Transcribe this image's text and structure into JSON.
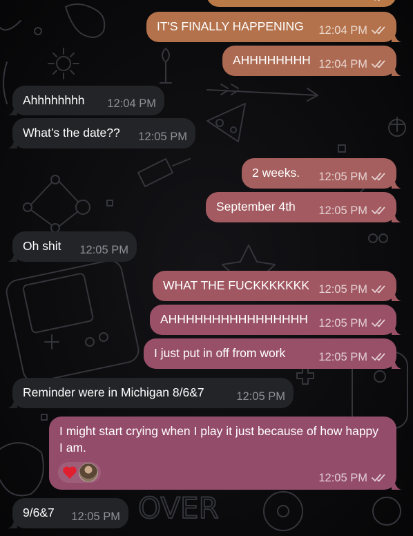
{
  "colors": {
    "incoming_bubble": "#232428",
    "outgoing_gradient": [
      "#b0704a",
      "#a85e5c",
      "#9a5068",
      "#874770"
    ],
    "wallpaper_background": "#0b0b0d",
    "wallpaper_doodle": "#3a3a40"
  },
  "messages": [
    {
      "id": "m1",
      "dir": "out",
      "text": "IT'S FINALLY HAPPENING",
      "time": "12:04 PM",
      "read": true
    },
    {
      "id": "m2",
      "dir": "out",
      "text": "AHHHHHHHH",
      "time": "12:04 PM",
      "read": true
    },
    {
      "id": "m3",
      "dir": "in",
      "text": "Ahhhhhhhh",
      "time": "12:04 PM"
    },
    {
      "id": "m4",
      "dir": "in",
      "text": "What’s the date??",
      "time": "12:05 PM"
    },
    {
      "id": "m5",
      "dir": "out",
      "text": "2 weeks.",
      "time": "12:05 PM",
      "read": true
    },
    {
      "id": "m6",
      "dir": "out",
      "text": "September 4th",
      "time": "12:05 PM",
      "read": true
    },
    {
      "id": "m7",
      "dir": "in",
      "text": "Oh shit",
      "time": "12:05 PM"
    },
    {
      "id": "m8",
      "dir": "out",
      "text": "WHAT THE FUCKKKKKKK",
      "time": "12:05 PM",
      "read": true
    },
    {
      "id": "m9",
      "dir": "out",
      "text": "AHHHHHHHHHHHHHHHH",
      "time": "12:05 PM",
      "read": true
    },
    {
      "id": "m10",
      "dir": "out",
      "text": "I just put in off from work",
      "time": "12:05 PM",
      "read": true
    },
    {
      "id": "m11",
      "dir": "in",
      "text": "Reminder were in Michigan 8/6&7",
      "time": "12:05 PM"
    },
    {
      "id": "m12",
      "dir": "out",
      "text": "I might start crying when I play it just because of how happy I am.",
      "time": "12:05 PM",
      "read": true,
      "reactions": {
        "emoji_icon": "red-heart-icon",
        "reactor": "avatar"
      }
    },
    {
      "id": "m13",
      "dir": "in",
      "text": "9/6&7",
      "time": "12:05 PM"
    }
  ]
}
